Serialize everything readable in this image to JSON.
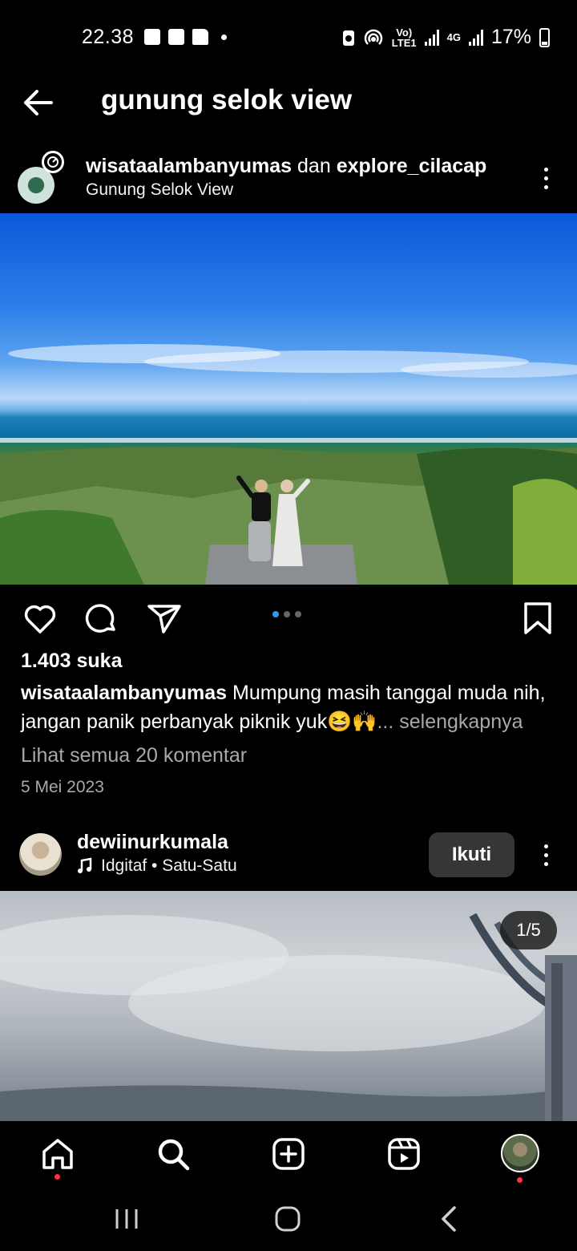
{
  "status_bar": {
    "time": "22.38",
    "battery": "17%",
    "network_1": "Vo) LTE1",
    "network_2": "4G"
  },
  "header": {
    "title": "gunung selok view",
    "back_icon": "arrow-left-icon"
  },
  "post1": {
    "user1": "wisataalambanyumas",
    "connector": "dan",
    "user2": "explore_cilacap",
    "location": "Gunung Selok View",
    "likes": "1.403 suka",
    "caption_user": "wisataalambanyumas",
    "caption_text": "Mumpung masih tanggal muda nih, jangan panik perbanyak piknik yuk😆🙌",
    "caption_more": "... selengkapnya",
    "comments": "Lihat semua 20 komentar",
    "date": "5 Mei 2023",
    "carousel_total": 3,
    "carousel_index": 1
  },
  "post2": {
    "username": "dewiinurkumala",
    "music_icon": "music-note-icon",
    "audio": "Idgitaf • Satu-Satu",
    "follow_label": "Ikuti",
    "counter": "1/5"
  },
  "bottom_nav": [
    "home-icon",
    "search-icon",
    "create-icon",
    "reels-icon",
    "profile-avatar"
  ],
  "colors": {
    "background": "#000000",
    "accent_blue": "#3797f0",
    "notification_red": "#ff3040",
    "muted_text": "#a8a8a8",
    "follow_button": "#363636"
  }
}
